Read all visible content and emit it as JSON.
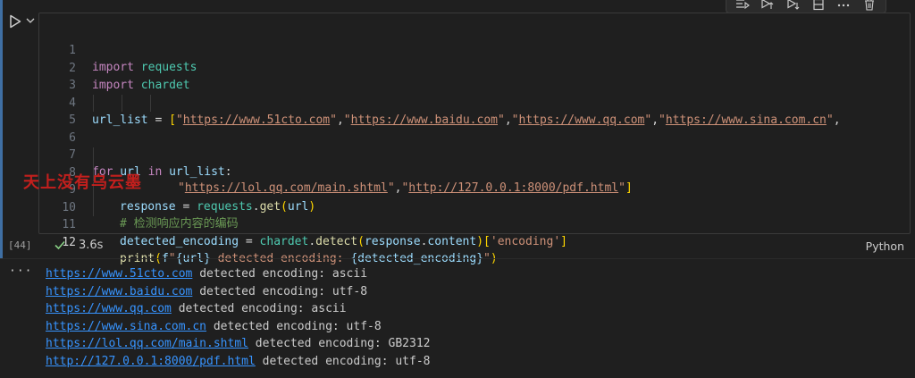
{
  "cell": {
    "execution_count": "[44]",
    "exec_time": "3.6s",
    "language": "Python",
    "toolbar_icons": [
      "run-by-line-icon",
      "execute-above-icon",
      "execute-below-icon",
      "split-cell-icon",
      "more-actions-icon",
      "delete-icon"
    ]
  },
  "code": {
    "line_numbers": [
      "1",
      "2",
      "3",
      "4",
      "5",
      "6",
      "7",
      "8",
      "9",
      "10",
      "11",
      "12"
    ],
    "l1": {
      "kw": "import",
      "mod": " requests"
    },
    "l2": {
      "kw": "import",
      "mod": " chardet"
    },
    "l4": {
      "var": "url_list",
      "eq": " = ",
      "open": "[",
      "q1": "\"",
      "u1": "https://www.51cto.com",
      "q1e": "\"",
      "c1": ",",
      "q2": "\"",
      "u2": "https://www.baidu.com",
      "q2e": "\"",
      "c2": ",",
      "q3": "\"",
      "u3": "https://www.qq.com",
      "q3e": "\"",
      "c3": ",",
      "q4": "\"",
      "u4": "https://www.sina.com.cn",
      "q4e": "\"",
      "c4": ","
    },
    "l5": {
      "q5": "\"",
      "u5": "https://lol.qq.com/main.shtml",
      "q5e": "\"",
      "c5": ",",
      "q6": "\"",
      "u6": "http://127.0.0.1:8000/pdf.html",
      "q6e": "\"",
      "close": "]"
    },
    "l7": {
      "for": "for",
      "var1": " url",
      "in": " in",
      "var2": " url_list",
      "colon": ":"
    },
    "l8": {
      "var": "response",
      "eq": " = ",
      "mod": "requests",
      "dot": ".",
      "fn": "get",
      "open": "(",
      "arg": "url",
      "close": ")"
    },
    "l9": {
      "comment": "# 检测响应内容的编码"
    },
    "l10": {
      "var": "detected_encoding",
      "eq": " = ",
      "mod": "chardet",
      "dot": ".",
      "fn": "detect",
      "open": "(",
      "arg": "response",
      "dot2": ".",
      "attr": "content",
      "close": ")",
      "sopen": "[",
      "key": "'encoding'",
      "sclose": "]"
    },
    "l11": {
      "fn": "print",
      "open": "(",
      "f": "f",
      "s1": "\"",
      "lb1": "{",
      "v1": "url",
      "rb1": "}",
      "mid": " detected encoding: ",
      "lb2": "{",
      "v2": "detected_encoding",
      "rb2": "}",
      "s2": "\"",
      "close": ")"
    }
  },
  "output": {
    "more": "···",
    "lines": [
      {
        "url": "https://www.51cto.com",
        "text": " detected encoding: ascii"
      },
      {
        "url": "https://www.baidu.com",
        "text": " detected encoding: utf-8"
      },
      {
        "url": "https://www.qq.com",
        "text": " detected encoding: ascii"
      },
      {
        "url": "https://www.sina.com.cn",
        "text": " detected encoding: utf-8"
      },
      {
        "url": "https://lol.qq.com/main.shtml",
        "text": " detected encoding: GB2312"
      },
      {
        "url": "http://127.0.0.1:8000/pdf.html",
        "text": " detected encoding: utf-8"
      }
    ]
  },
  "watermark": "天上没有乌云墨"
}
